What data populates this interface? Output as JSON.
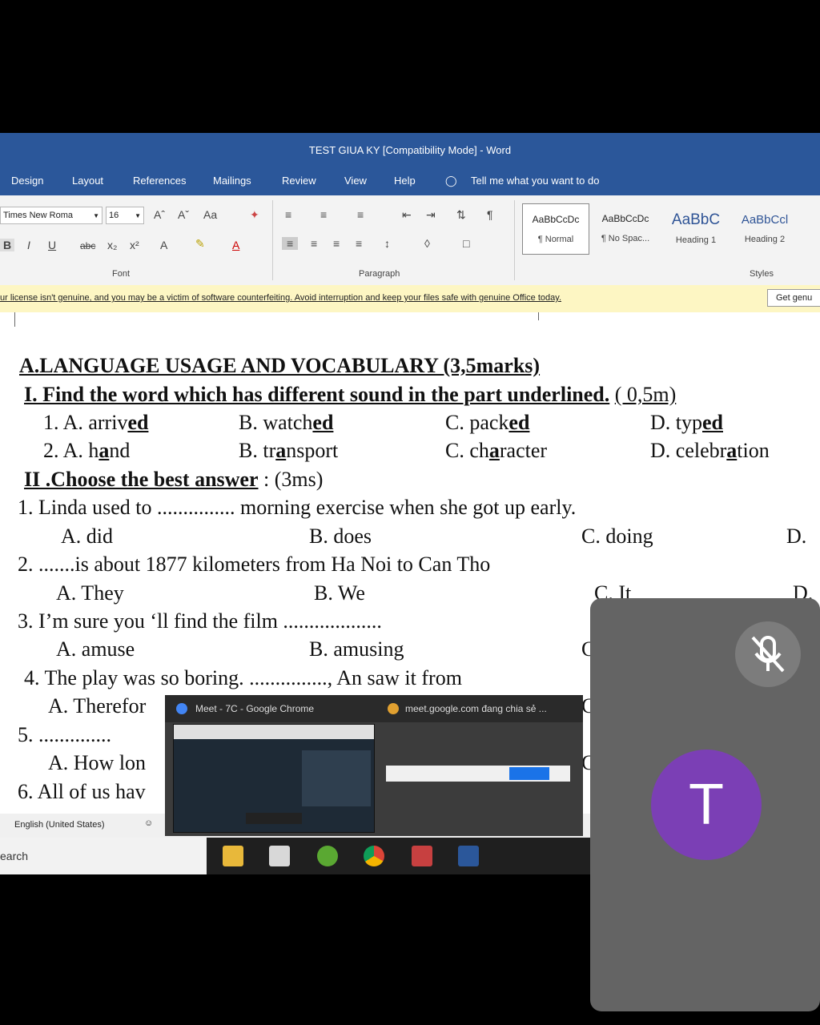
{
  "window": {
    "title": "TEST GIUA KY [Compatibility Mode] - Word"
  },
  "tabs": [
    "Design",
    "Layout",
    "References",
    "Mailings",
    "Review",
    "View",
    "Help"
  ],
  "tell_me": "Tell me what you want to do",
  "ribbon": {
    "font_name": "Times New Roma",
    "font_size": "16",
    "font_group": "Font",
    "paragraph_group": "Paragraph",
    "styles_group": "Styles",
    "styles": [
      {
        "sample": "AaBbCcDc",
        "name": "¶ Normal"
      },
      {
        "sample": "AaBbCcDc",
        "name": "¶ No Spac..."
      },
      {
        "sample": "AaBbC",
        "name": "Heading 1"
      },
      {
        "sample": "AaBbCcl",
        "name": "Heading 2"
      }
    ]
  },
  "banner": {
    "text": "ur license isn't genuine, and you may be a victim of software counterfeiting. Avoid interruption and keep your files safe with genuine Office today.",
    "button": "Get genu"
  },
  "doc": {
    "section_a": "A.LANGUAGE USAGE AND VOCABULARY (3,5marks)",
    "part1": {
      "label": "I. Find the word which has different sound in the part underlined.",
      "marks": "( 0,5m)"
    },
    "q1": {
      "num": "1. A.",
      "a_pre": "arriv",
      "a_ul": "ed",
      "b_pre": "B. watch",
      "b_ul": "ed",
      "c_pre": "C. pack",
      "c_ul": "ed",
      "d_pre": "D. typ",
      "d_ul": "ed"
    },
    "q2": {
      "num": "2. A.",
      "a_pre": "h",
      "a_ul": "a",
      "a_post": "nd",
      "b_pre": "B. tr",
      "b_ul": "a",
      "b_post": "nsport",
      "c_pre": "C. ch",
      "c_ul": "a",
      "c_post": "racter",
      "d_pre": "D. celebr",
      "d_ul": "a",
      "d_post": "tion"
    },
    "part2": {
      "label": "II .Choose the best answer",
      "marks": ": (3ms)"
    },
    "mc1": {
      "q": "1. Linda used to ............... morning exercise when she got up early.",
      "a": "A. did",
      "b": "B. does",
      "c": "C. doing",
      "d": "D."
    },
    "mc2": {
      "q": "2. .......is about 1877 kilometers from Ha Noi to Can Tho",
      "a": "A.  They",
      "b": "B. We",
      "c": "C. It",
      "d": "D."
    },
    "mc3": {
      "q": "3.  I’m sure you ‘ll find the film ...................",
      "a": "A.  amuse",
      "b": "B.  amusing",
      "c": "C"
    },
    "mc4": {
      "q": "4. The play was so boring. ..............., An saw it from",
      "a": "A. Therefor",
      "c": "C"
    },
    "mc5": {
      "q": "5. ..............",
      "a": "A. How lon",
      "c": "C"
    },
    "mc6": {
      "q": "6. All of us hav"
    }
  },
  "status": {
    "language": "English (United States)"
  },
  "taskbar": {
    "search": "earch"
  },
  "share_popup": {
    "window": "Meet - 7C - Google Chrome",
    "sharing": "meet.google.com đang chia sẻ ..."
  },
  "participant": {
    "initial": "T"
  },
  "colors": {
    "word_blue": "#2b579a",
    "avatar_purple": "#7b3fb5",
    "banner_yellow": "#fdf6c3"
  }
}
